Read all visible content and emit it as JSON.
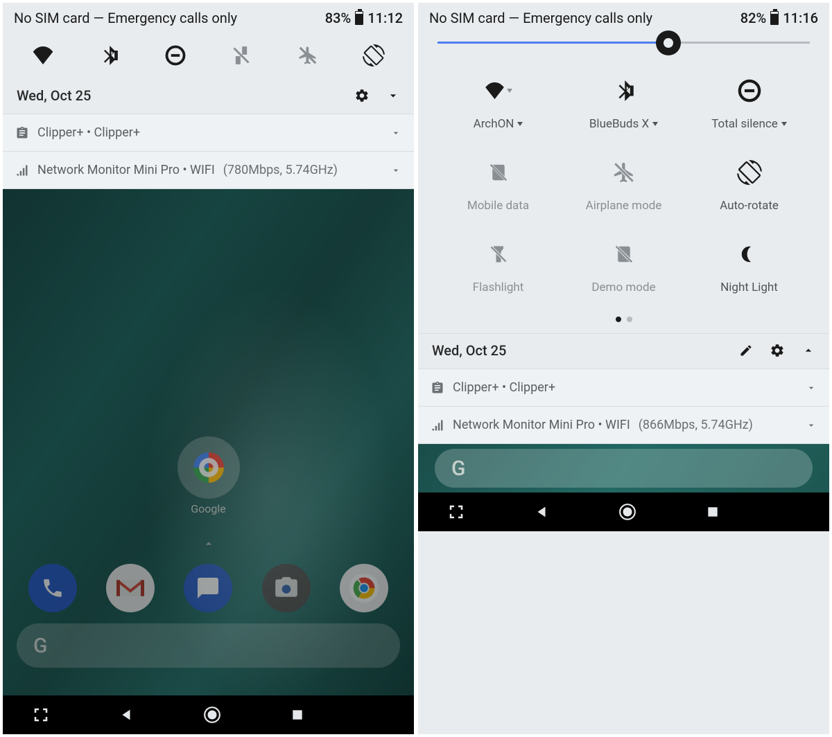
{
  "phone1": {
    "status": {
      "sim": "No SIM card — Emergency calls only",
      "battery": "83%",
      "time": "11:12"
    },
    "date": "Wed, Oct 25",
    "notif1": "Clipper+ • Clipper+",
    "notif2": {
      "app": "Network Monitor Mini Pro • WIFI",
      "detail": "(780Mbps, 5.74GHz)"
    },
    "google_label": "Google",
    "search_hint": "G"
  },
  "phone2": {
    "status": {
      "sim": "No SIM card — Emergency calls only",
      "battery": "82%",
      "time": "11:16"
    },
    "brightness_pct": 62,
    "tiles": [
      {
        "label": "ArchON",
        "chevron": true,
        "active": true
      },
      {
        "label": "BlueBuds X",
        "chevron": true,
        "active": true
      },
      {
        "label": "Total silence",
        "chevron": true,
        "active": true
      },
      {
        "label": "Mobile data",
        "chevron": false,
        "active": false
      },
      {
        "label": "Airplane mode",
        "chevron": false,
        "active": false
      },
      {
        "label": "Auto-rotate",
        "chevron": false,
        "active": true
      },
      {
        "label": "Flashlight",
        "chevron": false,
        "active": false
      },
      {
        "label": "Demo mode",
        "chevron": false,
        "active": false
      },
      {
        "label": "Night Light",
        "chevron": false,
        "active": true
      }
    ],
    "date": "Wed, Oct 25",
    "notif1": "Clipper+ • Clipper+",
    "notif2": {
      "app": "Network Monitor Mini Pro • WIFI",
      "detail": "(866Mbps, 5.74GHz)"
    },
    "search_hint": "G"
  }
}
